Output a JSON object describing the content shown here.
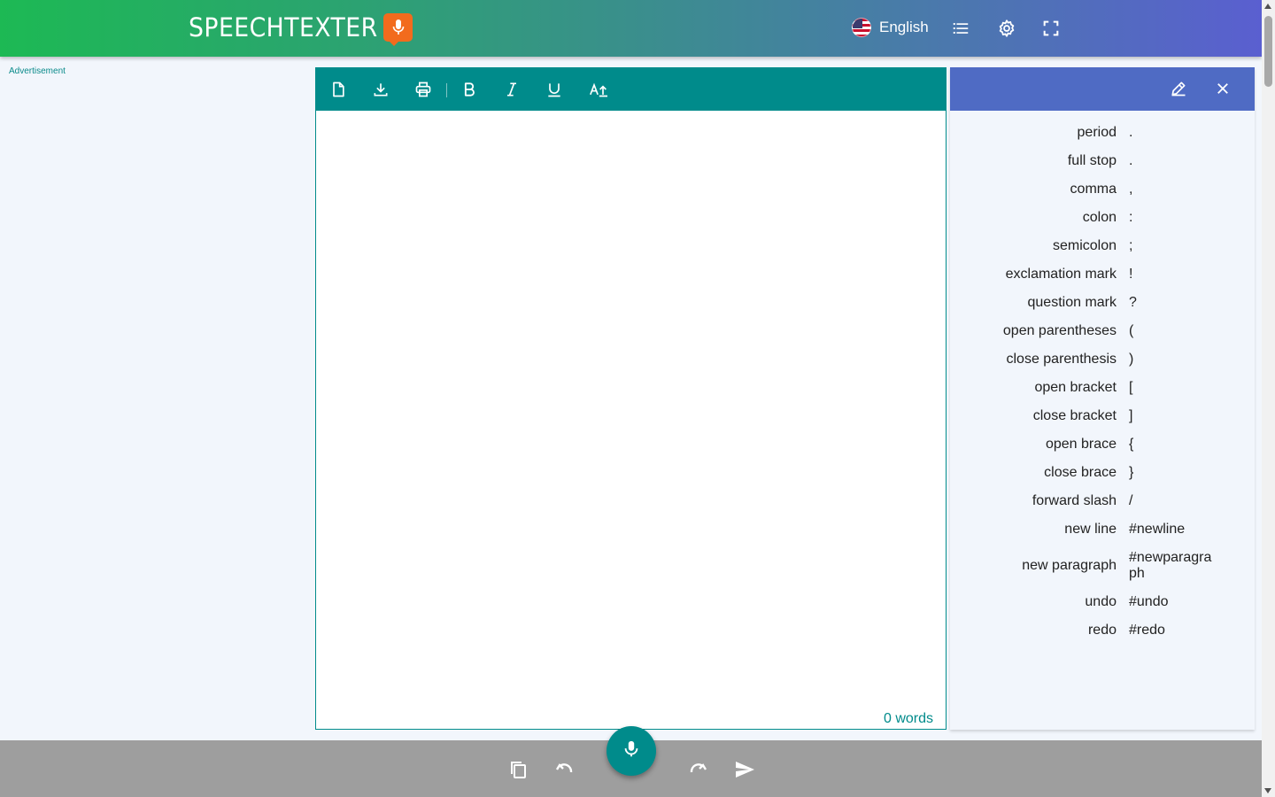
{
  "header": {
    "logo_text": "SPEECHTEXTER",
    "language": "English",
    "icons": [
      "mic-icon",
      "us-flag-icon",
      "list-icon",
      "gear-icon",
      "fullscreen-icon"
    ]
  },
  "ad": {
    "label": "Advertisement"
  },
  "editor": {
    "toolbar_icons": [
      "new-document-icon",
      "download-icon",
      "print-icon",
      "bold-icon",
      "italic-icon",
      "underline-icon",
      "font-size-icon"
    ],
    "word_count": "0 words"
  },
  "commands": {
    "header_icons": [
      "edit-icon",
      "close-icon"
    ],
    "items": [
      {
        "name": "period",
        "value": "."
      },
      {
        "name": "full stop",
        "value": "."
      },
      {
        "name": "comma",
        "value": ","
      },
      {
        "name": "colon",
        "value": ":"
      },
      {
        "name": "semicolon",
        "value": ";"
      },
      {
        "name": "exclamation mark",
        "value": "!"
      },
      {
        "name": "question mark",
        "value": "?"
      },
      {
        "name": "open parentheses",
        "value": "("
      },
      {
        "name": "close parenthesis",
        "value": ")"
      },
      {
        "name": "open bracket",
        "value": "["
      },
      {
        "name": "close bracket",
        "value": "]"
      },
      {
        "name": "open brace",
        "value": "{"
      },
      {
        "name": "close brace",
        "value": "}"
      },
      {
        "name": "forward slash",
        "value": "/"
      },
      {
        "name": "new line",
        "value": "#newline"
      },
      {
        "name": "new paragraph",
        "value": "#newparagraph"
      },
      {
        "name": "undo",
        "value": "#undo"
      },
      {
        "name": "redo",
        "value": "#redo"
      }
    ]
  },
  "bottom": {
    "icons": [
      "copy-icon",
      "undo-icon",
      "microphone-icon",
      "redo-icon",
      "send-icon"
    ]
  },
  "colors": {
    "teal": "#008b8b",
    "panel_header": "#4f6bc4",
    "logo_accent": "#f26b1d",
    "bottom_bar": "#9e9e9e"
  }
}
